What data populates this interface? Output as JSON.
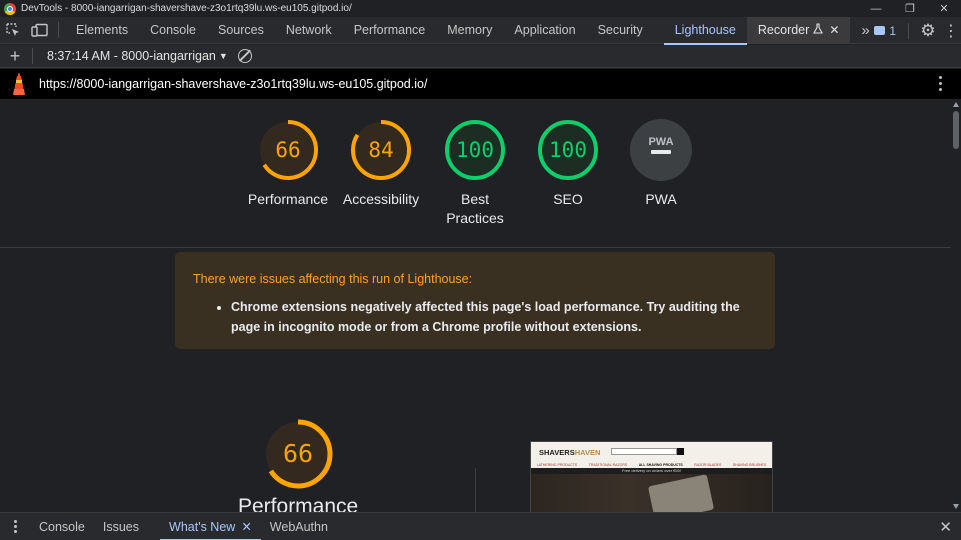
{
  "window": {
    "title": "DevTools - 8000-iangarrigan-shavershave-z3o1rtq39lu.ws-eu105.gitpod.io/",
    "controls": {
      "minimize": "—",
      "restore": "❐",
      "close": "✕"
    }
  },
  "toolbar": {
    "tabs": [
      {
        "label": "Elements"
      },
      {
        "label": "Console"
      },
      {
        "label": "Sources"
      },
      {
        "label": "Network"
      },
      {
        "label": "Performance"
      },
      {
        "label": "Memory"
      },
      {
        "label": "Application"
      },
      {
        "label": "Security"
      },
      {
        "label": "Lighthouse"
      },
      {
        "label": "Recorder"
      }
    ],
    "more": "»",
    "issues_count": "1",
    "settings": "⚙",
    "menu": "⋮"
  },
  "lighthouse_bar": {
    "add": "+",
    "report": "8:37:14 AM - 8000-iangarrigan"
  },
  "url_bar": {
    "url": "https://8000-iangarrigan-shavershave-z3o1rtq39lu.ws-eu105.gitpod.io/"
  },
  "scores": [
    {
      "value": "66",
      "label": "Performance",
      "level": 0.66,
      "color": "#ffa400"
    },
    {
      "value": "84",
      "label": "Accessibility",
      "level": 0.84,
      "color": "#ffa400"
    },
    {
      "value": "100",
      "label": "Best Practices",
      "level": 1.0,
      "color": "#0cce6b"
    },
    {
      "value": "100",
      "label": "SEO",
      "level": 1.0,
      "color": "#0cce6b"
    },
    {
      "value": "PWA",
      "label": "PWA",
      "level": 0,
      "color": "#9aa0a6"
    }
  ],
  "warning": {
    "heading": "There were issues affecting this run of Lighthouse:",
    "item": "Chrome extensions negatively affected this page's load performance. Try auditing the page in incognito mode or from a Chrome profile without extensions."
  },
  "performance_section": {
    "score": "66",
    "label": "Performance",
    "level": 0.66,
    "color": "#ffa400"
  },
  "screenshot": {
    "brand_a": "SHAVERS",
    "brand_b": "HAVEN",
    "nav": [
      "LATHERING PRODUCTS",
      "TRADITIONAL RAZORS",
      "ALL SHAVING PRODUCTS",
      "RAZOR BLADES",
      "SHAVING BRUSHES"
    ],
    "promo": "Free delivery on orders over €50!"
  },
  "drawer": {
    "tabs": [
      {
        "label": "Console"
      },
      {
        "label": "Issues"
      },
      {
        "label": "What's New"
      },
      {
        "label": "WebAuthn"
      }
    ]
  }
}
